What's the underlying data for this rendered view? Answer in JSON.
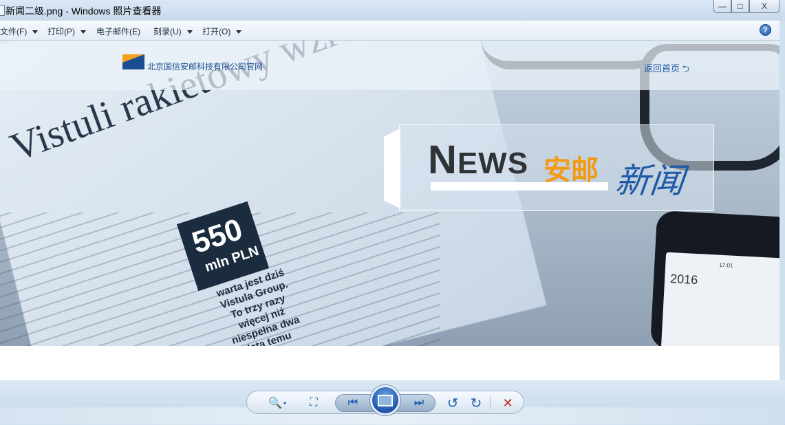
{
  "window": {
    "title": "新闻二级.png - Windows 照片查看器",
    "buttons": {
      "minimize": "—",
      "maximize": "□",
      "close": "X"
    }
  },
  "menubar": {
    "items": [
      {
        "label": "文件(F)",
        "has_caret": true
      },
      {
        "label": "打印(P)",
        "has_caret": true
      },
      {
        "label": "电子邮件(E)",
        "has_caret": false
      },
      {
        "label": "刻录(U)",
        "has_caret": true
      },
      {
        "label": "打开(O)",
        "has_caret": true
      }
    ],
    "help": "?"
  },
  "image": {
    "company_name": "北京国信安邮科技有限公司官网",
    "home_link": "返回首页",
    "banner": {
      "news_first": "N",
      "news_rest": "EWS",
      "news_cn": "安邮",
      "news_script": "新闻"
    },
    "newspaper": {
      "headline": "Vistuli rakietowy wzrost",
      "badge_number": "550",
      "badge_unit": "mln PLN",
      "quote": "warta jest dziś Vistula Group. To trzy razy więcej niż niespełna dwa lata temu"
    },
    "phone": {
      "time": "17:01",
      "year": "2016"
    }
  },
  "controls": {
    "zoom_icon": "🔍",
    "fit_icon": "⛶",
    "prev_icon": "⏮",
    "next_icon": "⏭",
    "rotate_ccw_icon": "↺",
    "rotate_cw_icon": "↻",
    "delete_icon": "✕"
  },
  "colors": {
    "accent": "#1e5aa6",
    "orange": "#f39a13",
    "delete": "#cc1f1f"
  }
}
